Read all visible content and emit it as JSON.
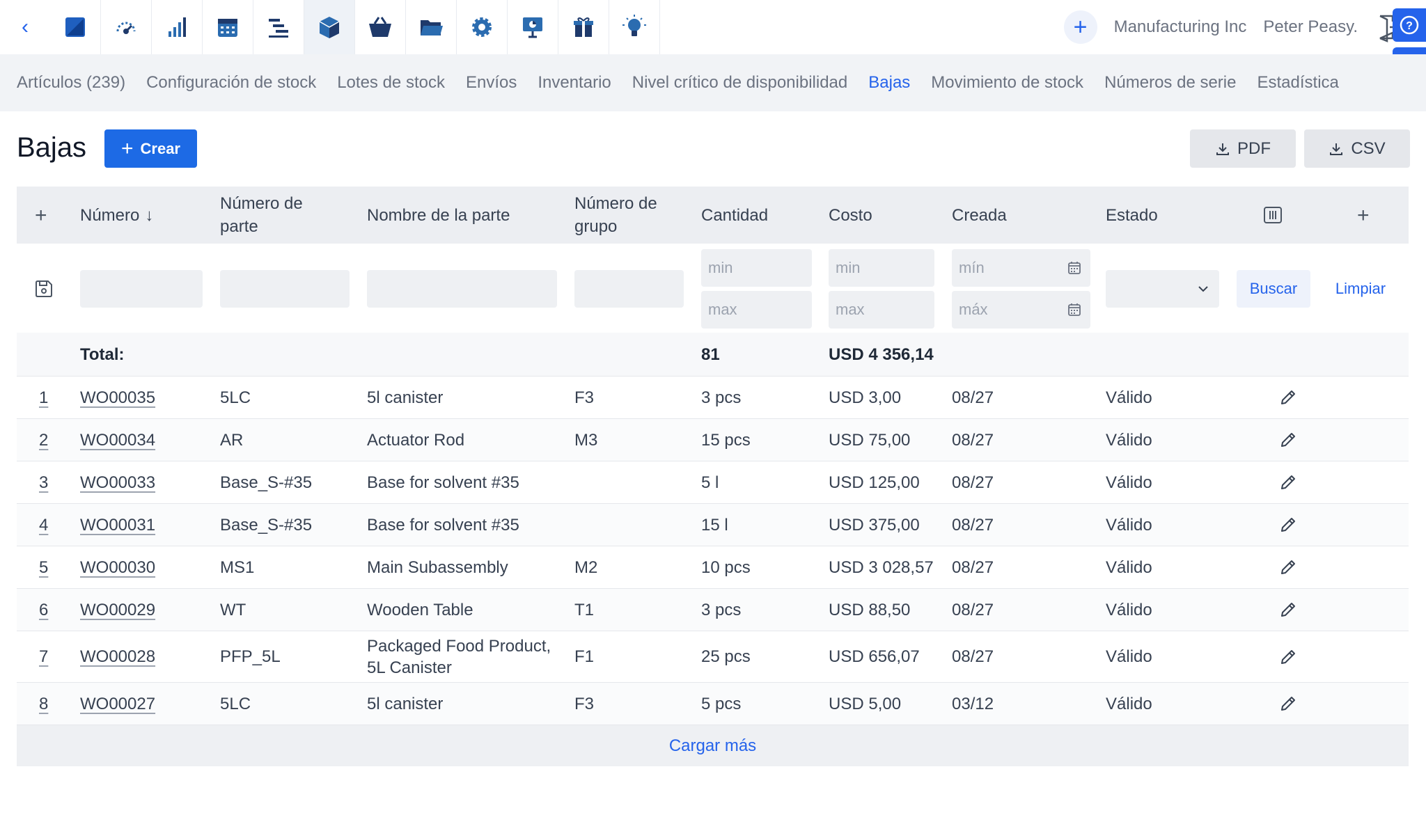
{
  "app": {
    "company": "Manufacturing Inc",
    "user": "Peter Peasy."
  },
  "modules": [
    "dashboard-icon",
    "speedometer-icon",
    "bar-chart-icon",
    "calendar-icon",
    "gantt-icon",
    "box-icon",
    "basket-icon",
    "folder-icon",
    "gear-icon",
    "presentation-icon",
    "gift-icon",
    "lightbulb-icon"
  ],
  "subnav": [
    {
      "label": "Artículos (239)"
    },
    {
      "label": "Configuración de stock"
    },
    {
      "label": "Lotes de stock"
    },
    {
      "label": "Envíos"
    },
    {
      "label": "Inventario"
    },
    {
      "label": "Nivel crítico de disponibilidad"
    },
    {
      "label": "Bajas",
      "active": true
    },
    {
      "label": "Movimiento de stock"
    },
    {
      "label": "Números de serie"
    },
    {
      "label": "Estadística"
    }
  ],
  "page": {
    "title": "Bajas",
    "create_label": "Crear",
    "pdf_label": "PDF",
    "csv_label": "CSV"
  },
  "columns": {
    "number": "Número",
    "part_number": "Número de parte",
    "part_name": "Nombre de la parte",
    "group_number": "Número de grupo",
    "quantity": "Cantidad",
    "cost": "Costo",
    "created": "Creada",
    "status": "Estado"
  },
  "filters": {
    "qty_min": "min",
    "qty_max": "max",
    "cost_min": "min",
    "cost_max": "max",
    "date_min": "mín",
    "date_max": "máx",
    "search_label": "Buscar",
    "clear_label": "Limpiar"
  },
  "totals": {
    "label": "Total:",
    "quantity": "81",
    "cost": "USD 4 356,14"
  },
  "rows": [
    {
      "n": "1",
      "number": "WO00035",
      "part_number": "5LC",
      "part_name": "5l canister",
      "group": "F3",
      "quantity": "3 pcs",
      "cost": "USD 3,00",
      "created": "08/27",
      "status": "Válido"
    },
    {
      "n": "2",
      "number": "WO00034",
      "part_number": "AR",
      "part_name": "Actuator Rod",
      "group": "M3",
      "quantity": "15 pcs",
      "cost": "USD 75,00",
      "created": "08/27",
      "status": "Válido"
    },
    {
      "n": "3",
      "number": "WO00033",
      "part_number": "Base_S-#35",
      "part_name": "Base for solvent #35",
      "group": "",
      "quantity": "5 l",
      "cost": "USD 125,00",
      "created": "08/27",
      "status": "Válido"
    },
    {
      "n": "4",
      "number": "WO00031",
      "part_number": "Base_S-#35",
      "part_name": "Base for solvent #35",
      "group": "",
      "quantity": "15 l",
      "cost": "USD 375,00",
      "created": "08/27",
      "status": "Válido"
    },
    {
      "n": "5",
      "number": "WO00030",
      "part_number": "MS1",
      "part_name": "Main Subassembly",
      "group": "M2",
      "quantity": "10 pcs",
      "cost": "USD 3 028,57",
      "created": "08/27",
      "status": "Válido"
    },
    {
      "n": "6",
      "number": "WO00029",
      "part_number": "WT",
      "part_name": "Wooden Table",
      "group": "T1",
      "quantity": "3 pcs",
      "cost": "USD 88,50",
      "created": "08/27",
      "status": "Válido"
    },
    {
      "n": "7",
      "number": "WO00028",
      "part_number": "PFP_5L",
      "part_name": "Packaged Food Product, 5L Canister",
      "group": "F1",
      "quantity": "25 pcs",
      "cost": "USD 656,07",
      "created": "08/27",
      "status": "Válido"
    },
    {
      "n": "8",
      "number": "WO00027",
      "part_number": "5LC",
      "part_name": "5l canister",
      "group": "F3",
      "quantity": "5 pcs",
      "cost": "USD 5,00",
      "created": "03/12",
      "status": "Válido"
    }
  ],
  "load_more": "Cargar más"
}
